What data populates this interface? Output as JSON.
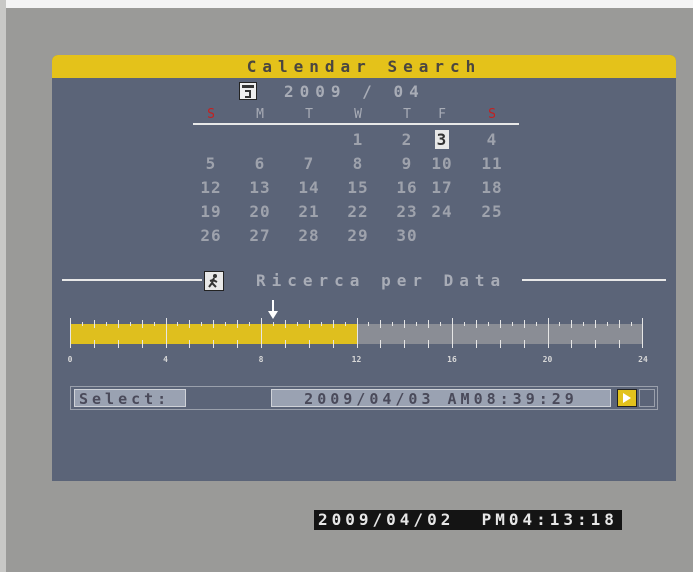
{
  "calendar": {
    "title": "Calendar Search",
    "year": "2009",
    "separator": "/",
    "month": "04",
    "weekdays": [
      {
        "label": "S",
        "sunday": true
      },
      {
        "label": "M",
        "sunday": false
      },
      {
        "label": "T",
        "sunday": false
      },
      {
        "label": "W",
        "sunday": false
      },
      {
        "label": "T",
        "sunday": false
      },
      {
        "label": "F",
        "sunday": false
      },
      {
        "label": "S",
        "sunday": true
      }
    ],
    "weeks": [
      [
        "",
        "",
        "",
        "1",
        "2",
        "3",
        "4"
      ],
      [
        "5",
        "6",
        "7",
        "8",
        "9",
        "10",
        "11"
      ],
      [
        "12",
        "13",
        "14",
        "15",
        "16",
        "17",
        "18"
      ],
      [
        "19",
        "20",
        "21",
        "22",
        "23",
        "24",
        "25"
      ],
      [
        "26",
        "27",
        "28",
        "29",
        "30",
        "",
        ""
      ]
    ],
    "selected_day": "3"
  },
  "search_mode": {
    "label": "Ricerca per Data",
    "icon": "walking-person-icon"
  },
  "timeline": {
    "hour_labels": [
      "0",
      "4",
      "8",
      "12",
      "16",
      "20",
      "24"
    ],
    "recorded_until_hour": 12,
    "pointer_hour": 8.5,
    "fill_color": "#dfbf1e"
  },
  "select": {
    "label": "Select:",
    "value": "2009/04/03  AM08:39:29"
  },
  "clock": "2009/04/02  PM04:13:18"
}
